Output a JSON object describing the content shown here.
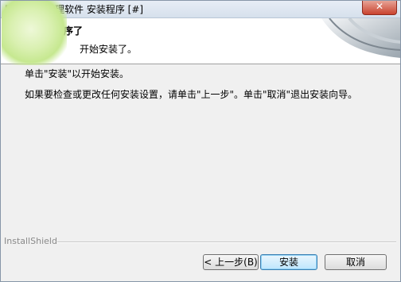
{
  "window": {
    "title": "[#] 吉星   管理软件 安装程序 [#]",
    "close_label": "✕"
  },
  "header": {
    "title": "可以安装程序了",
    "subtitle": "开始安装了。"
  },
  "content": {
    "line1": "单击\"安装\"以开始安装。",
    "line2": "如果要检查或更改任何安装设置，请单击\"上一步\"。单击\"取消\"退出安装向导。"
  },
  "footer": {
    "brand": "InstallShield"
  },
  "buttons": {
    "back": "< 上一步(B)",
    "install": "安装",
    "cancel": "取消"
  }
}
